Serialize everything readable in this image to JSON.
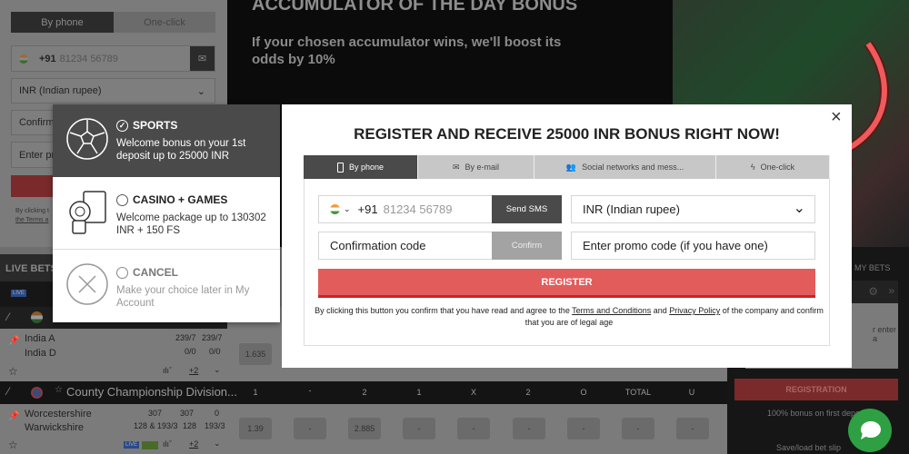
{
  "left_form": {
    "tab_phone": "By phone",
    "tab_oneclick": "One-click",
    "country_code": "+91",
    "phone_placeholder": "81234 56789",
    "currency": "INR (Indian rupee)",
    "confirmation": "Confirma",
    "promo": "Enter pro",
    "terms_line1": "By clicking t",
    "terms_line2": "the Terms a"
  },
  "banner": {
    "title": "ACCUMULATOR OF THE DAY BONUS",
    "subtitle": "If your chosen accumulator wins, we'll boost its odds by 10%"
  },
  "live": {
    "header": "LIVE BETS",
    "live_badge": "LIVE",
    "matches": [
      {
        "team1": "India A",
        "team2": "India D",
        "score1a": "239/7",
        "score1b": "239/7",
        "score2a": "0/0",
        "score2b": "0/0",
        "more": "+2",
        "odd": "1.635"
      },
      {
        "league": "County Championship Division...",
        "team1": "Worcestershire",
        "team2": "Warwickshire",
        "score1a": "307",
        "score1b": "307",
        "score1c": "0",
        "score2a": "128 & 193/3",
        "score2b": "128",
        "score2c": "193/3",
        "more": "+2",
        "odds": [
          "1.39",
          "-",
          "2.885",
          "-",
          "-",
          "-",
          "-",
          "-",
          "-"
        ]
      }
    ],
    "columns": [
      "1",
      "-",
      "2",
      "1",
      "X",
      "2",
      "O",
      "TOTAL",
      "U"
    ],
    "league_col": "1"
  },
  "slip": {
    "header": "MY BETS",
    "partial_text": "r enter a",
    "register": "REGISTRATION",
    "bonus": "100% bonus on first deposit",
    "save": "Save/load bet slip"
  },
  "chooser": {
    "options": [
      {
        "title": "SPORTS",
        "desc": "Welcome bonus on your 1st deposit up to 25000 INR",
        "selected": true
      },
      {
        "title": "CASINO + GAMES",
        "desc": "Welcome package up to 130302 INR + 150 FS",
        "selected": false
      },
      {
        "title": "CANCEL",
        "desc": "Make your choice later in My Account",
        "selected": false
      }
    ]
  },
  "modal": {
    "close": "×",
    "title": "REGISTER AND RECEIVE 25000 INR BONUS RIGHT NOW!",
    "tabs": [
      {
        "label": "By phone",
        "icon": "phone-icon"
      },
      {
        "label": "By e-mail",
        "icon": "envelope-icon"
      },
      {
        "label": "Social networks and mess...",
        "icon": "users-icon"
      },
      {
        "label": "One-click",
        "icon": "lightning-icon"
      }
    ],
    "country_code": "+91",
    "phone_placeholder": "81234 56789",
    "send_sms": "Send SMS",
    "currency": "INR (Indian rupee)",
    "confirmation_placeholder": "Confirmation code",
    "confirm": "Confirm",
    "promo_placeholder": "Enter promo code (if you have one)",
    "register": "REGISTER",
    "terms_pre": "By clicking this button you confirm that you have read and agree to the ",
    "terms_link": "Terms and Conditions",
    "terms_and": " and ",
    "privacy_link": "Privacy Policy",
    "terms_post": " of the company and confirm that you are of legal age"
  },
  "colors": {
    "register": "#e25c5c",
    "chat": "#2ea043",
    "arrow": "#f05a5a"
  }
}
